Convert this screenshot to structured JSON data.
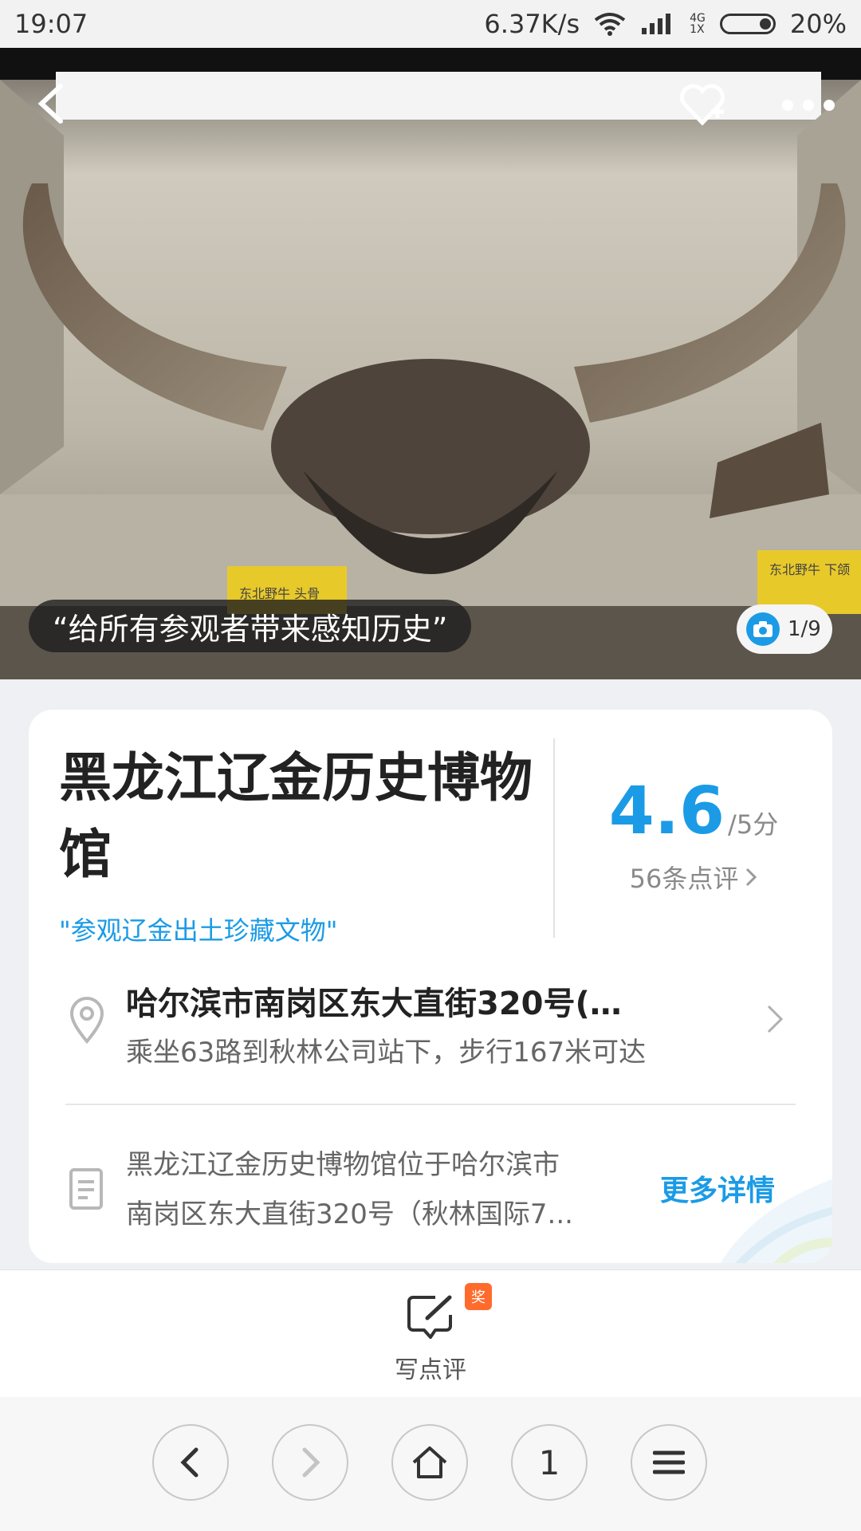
{
  "status_bar": {
    "time": "19:07",
    "speed": "6.37K/s",
    "net_top": "4G",
    "net_bottom": "1X",
    "battery": "20%"
  },
  "hero": {
    "quote": "“给所有参观者带来感知历史”",
    "photo_counter": "1/9",
    "label_left": "东北野牛 头骨",
    "label_right": "东北野牛 下颌"
  },
  "info": {
    "title_line1": "黑龙江辽金历史博物",
    "title_line2": "馆",
    "slogan": "\"参观辽金出土珍藏文物\"",
    "score": "4.6",
    "score_unit": "/5分",
    "review_count": "56条点评",
    "address": "哈尔滨市南岗区东大直街320号(秋林...",
    "directions": "乘坐63路到秋林公司站下，步行167米可达",
    "desc_line1": "黑龙江辽金历史博物馆位于哈尔滨市",
    "desc_line2": "南岗区东大直街320号（秋林国际7...",
    "more_details": "更多详情"
  },
  "review_bar": {
    "label": "写点评",
    "badge": "奖"
  },
  "browser_nav": {
    "tab_count": "1"
  },
  "colors": {
    "accent": "#1b9be6",
    "badge": "#ff6b2c"
  }
}
